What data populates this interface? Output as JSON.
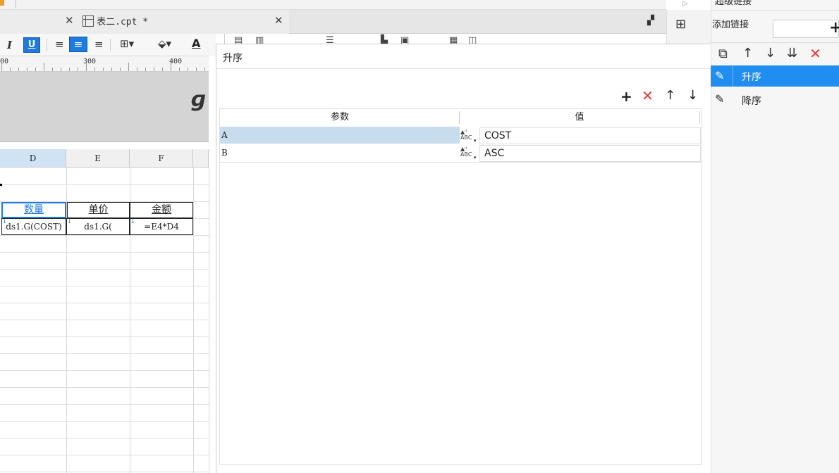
{
  "tabs": [
    {
      "label": "",
      "active": false
    },
    {
      "label": "表二.cpt *",
      "active": true
    }
  ],
  "ruler": {
    "marks": [
      "00",
      "300",
      "400"
    ]
  },
  "sheet": {
    "columns": [
      "D",
      "E",
      "F"
    ],
    "header_row": [
      "数量",
      "单价",
      "金额"
    ],
    "data_row": [
      "ds1.G(COST)",
      "ds1.G(",
      "=E4*D4"
    ]
  },
  "dialog": {
    "title": "升序",
    "table": {
      "headers": [
        "参数",
        "值"
      ],
      "rows": [
        {
          "name": "A",
          "type_icon": "ABC",
          "value": "COST",
          "selected": true
        },
        {
          "name": "B",
          "type_icon": "ABC",
          "value": "ASC",
          "selected": false
        }
      ]
    }
  },
  "right_panel": {
    "title": "超级链接",
    "add_link_label": "添加链接",
    "links": [
      {
        "label": "升序",
        "selected": true
      },
      {
        "label": "降序",
        "selected": false
      }
    ]
  },
  "colors": {
    "accent": "#1f7be0",
    "selected_row": "#c7dcec",
    "delete_red": "#e53935"
  }
}
